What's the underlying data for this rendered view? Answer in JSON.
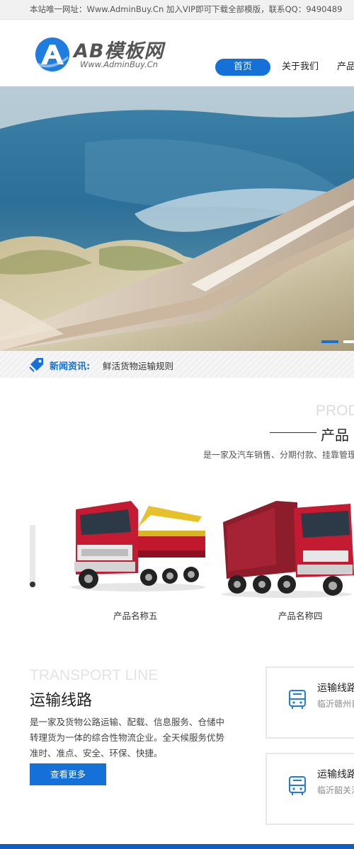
{
  "topbar": {
    "text": "本站唯一网址：Www.AdminBuy.Cn 加入VIP即可下载全部模版，联系QQ：9490489"
  },
  "logo": {
    "mark": "A",
    "title": "AB模板网",
    "subtitle": "Www.AdminBuy.Cn"
  },
  "nav": {
    "items": [
      "首页",
      "关于我们",
      "产品"
    ]
  },
  "banner": {
    "slides_total": 2,
    "active_slide": 1
  },
  "news": {
    "label": "新闻资讯:",
    "headline": "鲜活货物运输规则"
  },
  "products": {
    "title_en": "PROD",
    "title": "产品",
    "description": "是一家及汽车销售、分期付款、挂靠管理、",
    "items": [
      {
        "name": "产品名称五"
      },
      {
        "name": "产品名称四"
      }
    ]
  },
  "transport": {
    "title_en": "TRANSPORT LINE",
    "title": "运输线路",
    "description": "是一家及货物公路运输、配载、信息服务、仓储中转理货为一体的综合性物流企业。全天候服务优势准时、准点、安全、环保、快捷。",
    "more_label": "查看更多",
    "cards": [
      {
        "title": "运输线路",
        "subtitle": "临沂赣州音"
      },
      {
        "title": "运输线路",
        "subtitle": "临沂韶关江"
      }
    ]
  },
  "colors": {
    "accent": "#1570d8",
    "footer": "#0d5fc4"
  }
}
